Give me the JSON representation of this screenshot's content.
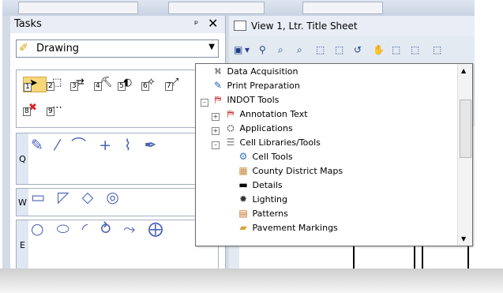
{
  "tasks": {
    "title": "Tasks",
    "pin_glyph": "ᵖ",
    "close_glyph": "✕",
    "dropdown_value": "Drawing",
    "tool_numbers": [
      "1",
      "2",
      "3",
      "4",
      "5",
      "6",
      "7",
      "8",
      "9"
    ],
    "groups": [
      {
        "label": "Q",
        "icons": "✎ ⁄ ⌒ + ⌇ ✒"
      },
      {
        "label": "W",
        "icons": "▭ ◸ ◇ ◎"
      },
      {
        "label": "E",
        "icons": "○ ⬭ ◜ ⥁ ⤳ ⨁"
      }
    ]
  },
  "view": {
    "title": "View 1, Ltr. Title Sheet",
    "toolbar_glyphs": [
      "▣",
      "▾",
      "⚲",
      "⌕",
      "⌕",
      "⬚",
      "⬚",
      "↺",
      "✋",
      "⬚",
      "⬚",
      "⬚"
    ]
  },
  "tree": {
    "items": [
      {
        "label": "Data Acquisition"
      },
      {
        "label": "Print Preparation"
      },
      {
        "label": "INDOT Tools"
      },
      {
        "label": "Annotation Text"
      },
      {
        "label": "Applications"
      },
      {
        "label": "Cell Libraries/Tools"
      },
      {
        "label": "Cell Tools"
      },
      {
        "label": "County District Maps"
      },
      {
        "label": "Details"
      },
      {
        "label": "Lighting"
      },
      {
        "label": "Patterns"
      },
      {
        "label": "Pavement Markings"
      }
    ]
  },
  "colors": {
    "frame": "#d4dbe6",
    "header": "#e9eef6",
    "accent": "#f7d77a"
  }
}
